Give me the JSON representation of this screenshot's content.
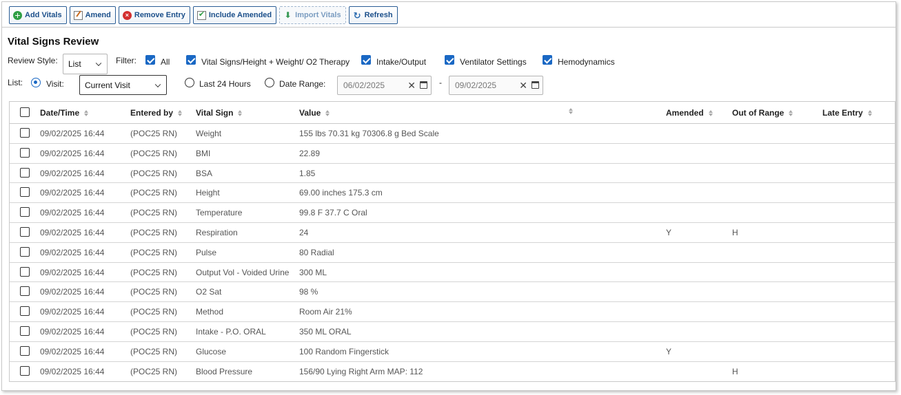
{
  "toolbar": {
    "add_vitals": "Add Vitals",
    "amend": "Amend",
    "remove_entry": "Remove Entry",
    "include_amended": "Include Amended",
    "import_vitals": "Import Vitals",
    "refresh": "Refresh"
  },
  "page_title": "Vital Signs Review",
  "review_style": {
    "label": "Review Style:",
    "value": "List"
  },
  "filter": {
    "label": "Filter:",
    "options": [
      {
        "label": "All",
        "checked": true
      },
      {
        "label": "Vital Signs/Height + Weight/ O2 Therapy",
        "checked": true
      },
      {
        "label": "Intake/Output",
        "checked": true
      },
      {
        "label": "Ventilator Settings",
        "checked": true
      },
      {
        "label": "Hemodynamics",
        "checked": true
      }
    ]
  },
  "list": {
    "label": "List:",
    "visit_label": "Visit:",
    "visit_value": "Current Visit",
    "last24_label": "Last 24 Hours",
    "date_range_label": "Date Range:",
    "date_from": "06/02/2025",
    "date_to": "09/02/2025",
    "separator": "-"
  },
  "table": {
    "columns": [
      "Date/Time",
      "Entered by",
      "Vital Sign",
      "Value",
      "Amended",
      "Out of Range",
      "Late Entry"
    ],
    "rows": [
      {
        "datetime": "09/02/2025 16:44",
        "entered_by": "(POC25 RN)",
        "vital_sign": "Weight",
        "value": "155 lbs 70.31 kg 70306.8 g Bed Scale",
        "amended": "",
        "out_of_range": "",
        "late_entry": ""
      },
      {
        "datetime": "09/02/2025 16:44",
        "entered_by": "(POC25 RN)",
        "vital_sign": "BMI",
        "value": "22.89",
        "amended": "",
        "out_of_range": "",
        "late_entry": ""
      },
      {
        "datetime": "09/02/2025 16:44",
        "entered_by": "(POC25 RN)",
        "vital_sign": "BSA",
        "value": "1.85",
        "amended": "",
        "out_of_range": "",
        "late_entry": ""
      },
      {
        "datetime": "09/02/2025 16:44",
        "entered_by": "(POC25 RN)",
        "vital_sign": "Height",
        "value": "69.00 inches 175.3 cm",
        "amended": "",
        "out_of_range": "",
        "late_entry": ""
      },
      {
        "datetime": "09/02/2025 16:44",
        "entered_by": "(POC25 RN)",
        "vital_sign": "Temperature",
        "value": "99.8 F 37.7 C Oral",
        "amended": "",
        "out_of_range": "",
        "late_entry": ""
      },
      {
        "datetime": "09/02/2025 16:44",
        "entered_by": "(POC25 RN)",
        "vital_sign": "Respiration",
        "value": "24",
        "amended": "Y",
        "out_of_range": "H",
        "late_entry": ""
      },
      {
        "datetime": "09/02/2025 16:44",
        "entered_by": "(POC25 RN)",
        "vital_sign": "Pulse",
        "value": "80 Radial",
        "amended": "",
        "out_of_range": "",
        "late_entry": ""
      },
      {
        "datetime": "09/02/2025 16:44",
        "entered_by": "(POC25 RN)",
        "vital_sign": "Output Vol - Voided Urine",
        "value": "300 ML",
        "amended": "",
        "out_of_range": "",
        "late_entry": ""
      },
      {
        "datetime": "09/02/2025 16:44",
        "entered_by": "(POC25 RN)",
        "vital_sign": "O2 Sat",
        "value": "98 %",
        "amended": "",
        "out_of_range": "",
        "late_entry": ""
      },
      {
        "datetime": "09/02/2025 16:44",
        "entered_by": "(POC25 RN)",
        "vital_sign": "Method",
        "value": "Room Air 21%",
        "amended": "",
        "out_of_range": "",
        "late_entry": ""
      },
      {
        "datetime": "09/02/2025 16:44",
        "entered_by": "(POC25 RN)",
        "vital_sign": "Intake - P.O. ORAL",
        "value": "350 ML ORAL",
        "amended": "",
        "out_of_range": "",
        "late_entry": ""
      },
      {
        "datetime": "09/02/2025 16:44",
        "entered_by": "(POC25 RN)",
        "vital_sign": "Glucose",
        "value": "100 Random Fingerstick",
        "amended": "Y",
        "out_of_range": "",
        "late_entry": ""
      },
      {
        "datetime": "09/02/2025 16:44",
        "entered_by": "(POC25 RN)",
        "vital_sign": "Blood Pressure",
        "value": "156/90 Lying Right Arm MAP: 112",
        "amended": "",
        "out_of_range": "H",
        "late_entry": ""
      }
    ]
  }
}
